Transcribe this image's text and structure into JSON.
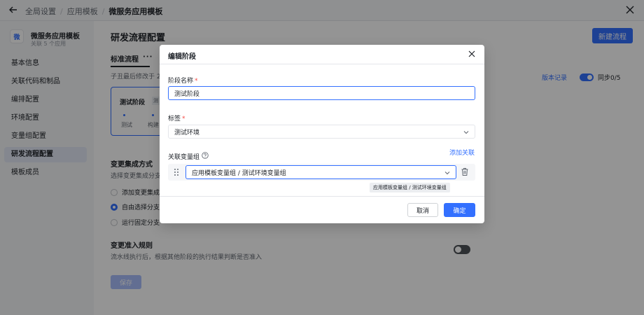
{
  "breadcrumb": {
    "items": [
      "全局设置",
      "应用模板"
    ],
    "current": "微服务应用模板"
  },
  "sidebar": {
    "app": {
      "logo_text": "微",
      "name": "微服务应用模板",
      "sub": "关联 5 个应用"
    },
    "items": [
      {
        "label": "基本信息"
      },
      {
        "label": "关联代码和制品"
      },
      {
        "label": "编排配置"
      },
      {
        "label": "环境配置"
      },
      {
        "label": "变量组配置"
      },
      {
        "label": "研发流程配置"
      },
      {
        "label": "模板成员"
      }
    ],
    "active_index": 5
  },
  "main": {
    "title": "研发流程配置",
    "new_button": "新建流程",
    "tab": "标准流程",
    "tab_more": "···",
    "subline": "子丑最后修改于 2",
    "version_link": "版本记录",
    "sync_label": "同步0/5",
    "stage_card": {
      "title": "测试阶段",
      "tag": "测",
      "step1": "测试",
      "step2": "构建"
    },
    "merge_section": {
      "title": "变更集成方式",
      "desc": "选择变更集成分支的方式",
      "options": [
        "添加变更集成",
        "自由选择分支",
        "运行固定分支"
      ],
      "selected_index": 1
    },
    "rule_section": {
      "title": "变更准入规则",
      "desc": "流水线执行后，根据其他阶段的执行结果判断是否准入"
    },
    "save_button": "保存"
  },
  "dialog": {
    "title": "编辑阶段",
    "name_label": "阶段名称",
    "name_value": "测试阶段",
    "tag_label": "标签",
    "tag_value": "测试环境",
    "var_label": "关联变量组",
    "add_link": "添加关联",
    "var_value": "应用模板变量组 / 测试环境变量组",
    "tooltip": "应用模板变量组 / 测试环境变量组",
    "cancel_button": "取消",
    "ok_button": "确定"
  }
}
